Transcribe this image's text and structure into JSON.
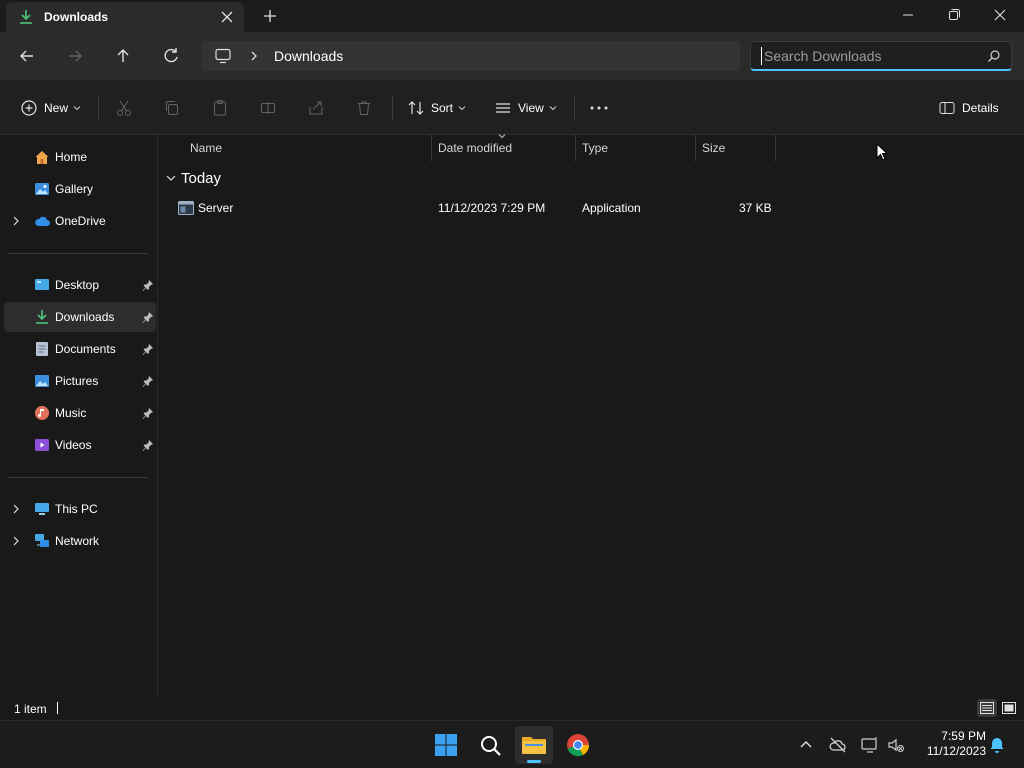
{
  "window": {
    "tab_title": "Downloads",
    "colors": {
      "accent": "#4cc2ff",
      "folder": "#f5c244"
    }
  },
  "addressbar": {
    "location_icon": "pc-icon",
    "breadcrumb": [
      "Downloads"
    ],
    "search_placeholder": "Search Downloads"
  },
  "commandbar": {
    "new_label": "New",
    "sort_label": "Sort",
    "view_label": "View",
    "details_label": "Details"
  },
  "sidebar": {
    "top": [
      {
        "label": "Home",
        "icon": "home-icon",
        "expandable": false
      },
      {
        "label": "Gallery",
        "icon": "gallery-icon",
        "expandable": false
      },
      {
        "label": "OneDrive",
        "icon": "onedrive-icon",
        "expandable": true
      }
    ],
    "pinned": [
      {
        "label": "Desktop",
        "icon": "desktop-icon"
      },
      {
        "label": "Downloads",
        "icon": "downloads-icon",
        "selected": true
      },
      {
        "label": "Documents",
        "icon": "documents-icon"
      },
      {
        "label": "Pictures",
        "icon": "pictures-icon"
      },
      {
        "label": "Music",
        "icon": "music-icon"
      },
      {
        "label": "Videos",
        "icon": "videos-icon"
      }
    ],
    "bottom": [
      {
        "label": "This PC",
        "icon": "this-pc-icon",
        "expandable": true
      },
      {
        "label": "Network",
        "icon": "network-icon",
        "expandable": true
      }
    ]
  },
  "content": {
    "columns": {
      "name": "Name",
      "date": "Date modified",
      "type": "Type",
      "size": "Size"
    },
    "group_label": "Today",
    "files": [
      {
        "name": "Server",
        "date": "11/12/2023 7:29 PM",
        "type": "Application",
        "size": "37 KB",
        "icon": "application-icon"
      }
    ]
  },
  "statusbar": {
    "item_count": "1 item"
  },
  "taskbar": {
    "time": "7:59 PM",
    "date": "11/12/2023"
  }
}
